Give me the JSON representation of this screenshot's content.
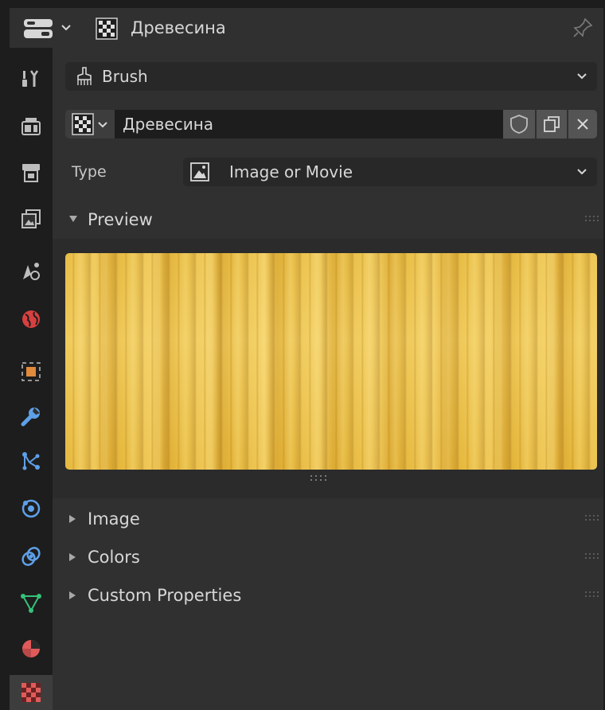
{
  "header": {
    "texture_name": "Древесина",
    "pinned": false
  },
  "tabs": [
    {
      "name": "tool",
      "icon": "tool-icon",
      "color": "#bdbdbd"
    },
    {
      "name": "render",
      "icon": "render-icon",
      "color": "#bdbdbd"
    },
    {
      "name": "output",
      "icon": "output-icon",
      "color": "#bdbdbd"
    },
    {
      "name": "view-layer",
      "icon": "view-layer-icon",
      "color": "#bdbdbd"
    },
    {
      "name": "scene",
      "icon": "scene-icon",
      "color": "#bdbdbd"
    },
    {
      "name": "world",
      "icon": "world-icon",
      "color": "#d64040"
    },
    {
      "name": "object",
      "icon": "object-icon",
      "color": "#e08a3c"
    },
    {
      "name": "modifiers",
      "icon": "wrench-icon",
      "color": "#5ea0e8"
    },
    {
      "name": "particles",
      "icon": "particles-icon",
      "color": "#5ea0e8"
    },
    {
      "name": "physics",
      "icon": "physics-icon",
      "color": "#5ea0e8"
    },
    {
      "name": "constraints",
      "icon": "constraints-icon",
      "color": "#5ea0e8"
    },
    {
      "name": "data",
      "icon": "mesh-data-icon",
      "color": "#35c27a"
    },
    {
      "name": "material",
      "icon": "material-icon",
      "color": "#e05a5a"
    },
    {
      "name": "texture",
      "icon": "texture-icon",
      "color": "#e05a5a",
      "active": true
    }
  ],
  "context": {
    "value": "Brush"
  },
  "texture_id": {
    "name": "Древесина"
  },
  "type_prop": {
    "label": "Type",
    "value": "Image or Movie"
  },
  "panels": {
    "preview": {
      "title": "Preview",
      "expanded": true
    },
    "image": {
      "title": "Image",
      "expanded": false
    },
    "colors": {
      "title": "Colors",
      "expanded": false
    },
    "custom_properties": {
      "title": "Custom Properties",
      "expanded": false
    }
  }
}
